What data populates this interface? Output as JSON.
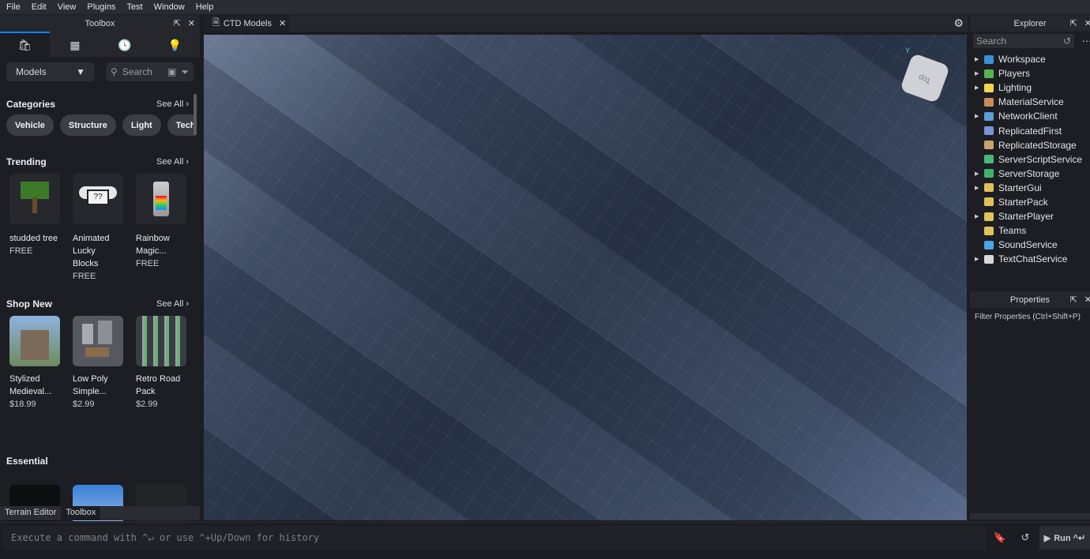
{
  "menu": [
    "File",
    "Edit",
    "View",
    "Plugins",
    "Test",
    "Window",
    "Help"
  ],
  "toolbox": {
    "title": "Toolbox",
    "dropdown": "Models",
    "search_placeholder": "Search",
    "categories": {
      "title": "Categories",
      "see_all": "See All",
      "chips": [
        "Vehicle",
        "Structure",
        "Light",
        "Tech"
      ]
    },
    "trending": {
      "title": "Trending",
      "see_all": "See All",
      "items": [
        {
          "name1": "studded tree",
          "name2": "",
          "price": "FREE"
        },
        {
          "name1": "Animated",
          "name2": "Lucky Blocks",
          "price": "FREE"
        },
        {
          "name1": "Rainbow",
          "name2": "Magic...",
          "price": "FREE"
        }
      ]
    },
    "shop_new": {
      "title": "Shop New",
      "see_all": "See All",
      "items": [
        {
          "name1": "Stylized",
          "name2": "Medieval...",
          "price": "$18.99"
        },
        {
          "name1": "Low Poly",
          "name2": "Simple...",
          "price": "$2.99"
        },
        {
          "name1": "Retro Road",
          "name2": "Pack",
          "price": "$2.99"
        }
      ]
    },
    "essential": {
      "title": "Essential"
    },
    "bottom_tabs": [
      "Terrain Editor",
      "Toolbox"
    ]
  },
  "viewport": {
    "tab": "CTD Models",
    "cube_label": "Top",
    "gizmo_axis": "Y"
  },
  "explorer": {
    "title": "Explorer",
    "search_placeholder": "Search",
    "nodes": [
      {
        "label": "Workspace",
        "arrow": true,
        "icon_color": "#3a8fd8"
      },
      {
        "label": "Players",
        "arrow": true,
        "icon_color": "#56b74b"
      },
      {
        "label": "Lighting",
        "arrow": true,
        "icon_color": "#f2d54a"
      },
      {
        "label": "MaterialService",
        "arrow": false,
        "icon_color": "#c98a5a"
      },
      {
        "label": "NetworkClient",
        "arrow": true,
        "icon_color": "#5a9fd8"
      },
      {
        "label": "ReplicatedFirst",
        "arrow": false,
        "icon_color": "#7a93d8"
      },
      {
        "label": "ReplicatedStorage",
        "arrow": false,
        "icon_color": "#c9a36a"
      },
      {
        "label": "ServerScriptService",
        "arrow": false,
        "icon_color": "#4bb77a"
      },
      {
        "label": "ServerStorage",
        "arrow": true,
        "icon_color": "#3fb36d"
      },
      {
        "label": "StarterGui",
        "arrow": true,
        "icon_color": "#e0c25a"
      },
      {
        "label": "StarterPack",
        "arrow": false,
        "icon_color": "#e0c25a"
      },
      {
        "label": "StarterPlayer",
        "arrow": true,
        "icon_color": "#e0c25a"
      },
      {
        "label": "Teams",
        "arrow": false,
        "icon_color": "#e0c25a"
      },
      {
        "label": "SoundService",
        "arrow": false,
        "icon_color": "#4aa6e0"
      },
      {
        "label": "TextChatService",
        "arrow": true,
        "icon_color": "#d8d8d8"
      }
    ]
  },
  "properties": {
    "title": "Properties",
    "filter": "Filter Properties (Ctrl+Shift+P)"
  },
  "command": {
    "placeholder": "Execute a command with ^↵ or use ^+Up/Down for history",
    "run": "Run ^↵"
  }
}
